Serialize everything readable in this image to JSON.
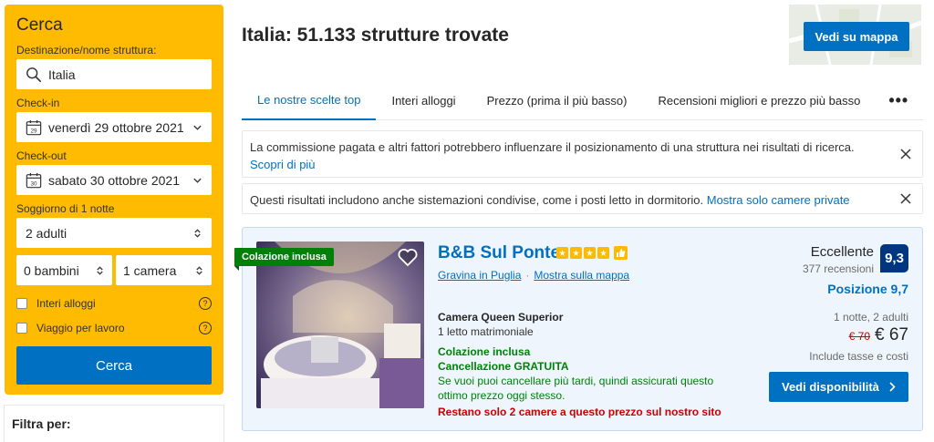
{
  "search": {
    "title": "Cerca",
    "destination_label": "Destinazione/nome struttura:",
    "destination_value": "Italia",
    "checkin_label": "Check-in",
    "checkin_value": "venerdì 29 ottobre 2021",
    "checkin_day": "29",
    "checkout_label": "Check-out",
    "checkout_value": "sabato 30 ottobre 2021",
    "checkout_day": "30",
    "stay_label": "Soggiorno di 1 notte",
    "adults": "2 adulti",
    "children": "0 bambini",
    "rooms": "1 camera",
    "checkbox_entire": "Interi alloggi",
    "checkbox_work": "Viaggio per lavoro",
    "help_glyph": "?",
    "button": "Cerca"
  },
  "filter": {
    "title": "Filtra per:"
  },
  "header": {
    "results_title": "Italia: 51.133 strutture trovate",
    "map_button": "Vedi su mappa"
  },
  "tabs": [
    {
      "label": "Le nostre scelte top",
      "active": true
    },
    {
      "label": "Interi alloggi",
      "active": false
    },
    {
      "label": "Prezzo (prima il più basso)",
      "active": false
    },
    {
      "label": "Recensioni migliori e prezzo più basso",
      "active": false
    },
    {
      "label": "•••",
      "active": false
    }
  ],
  "notices": [
    {
      "text": "La commissione pagata e altri fattori potrebbero influenzare il posizionamento di una struttura nei risultati di ricerca. ",
      "link": "Scopri di più"
    },
    {
      "text": "Questi risultati includono anche sistemazioni condivise, come i posti letto in dormitorio. ",
      "link": "Mostra solo camere private"
    }
  ],
  "property": {
    "ribbon": "Colazione inclusa",
    "name": "B&B Sul Ponte",
    "stars": 4,
    "city": "Gravina in Puglia",
    "separator": "·",
    "map_link": "Mostra sulla mappa",
    "room_name": "Camera Queen Superior",
    "bed": "1 letto matrimoniale",
    "breakfast": "Colazione inclusa",
    "cancellation": "Cancellazione GRATUITA",
    "cancellation_note": "Se vuoi puoi cancellare più tardi, quindi assicurati questo ottimo prezzo oggi stesso.",
    "scarcity": "Restano solo 2 camere a questo prezzo sul nostro sito",
    "review_word": "Eccellente",
    "review_count": "377 recensioni",
    "score": "9,3",
    "location_score": "Posizione 9,7",
    "nights": "1 notte, 2 adulti",
    "old_price": "€ 70",
    "new_price": "€ 67",
    "tax_note": "Include tasse e costi",
    "cta": "Vedi disponibilità"
  },
  "colors": {
    "brand_blue": "#0071c2",
    "brand_yellow": "#febb02",
    "score_navy": "#003580",
    "green": "#008009",
    "red": "#cc0000"
  }
}
